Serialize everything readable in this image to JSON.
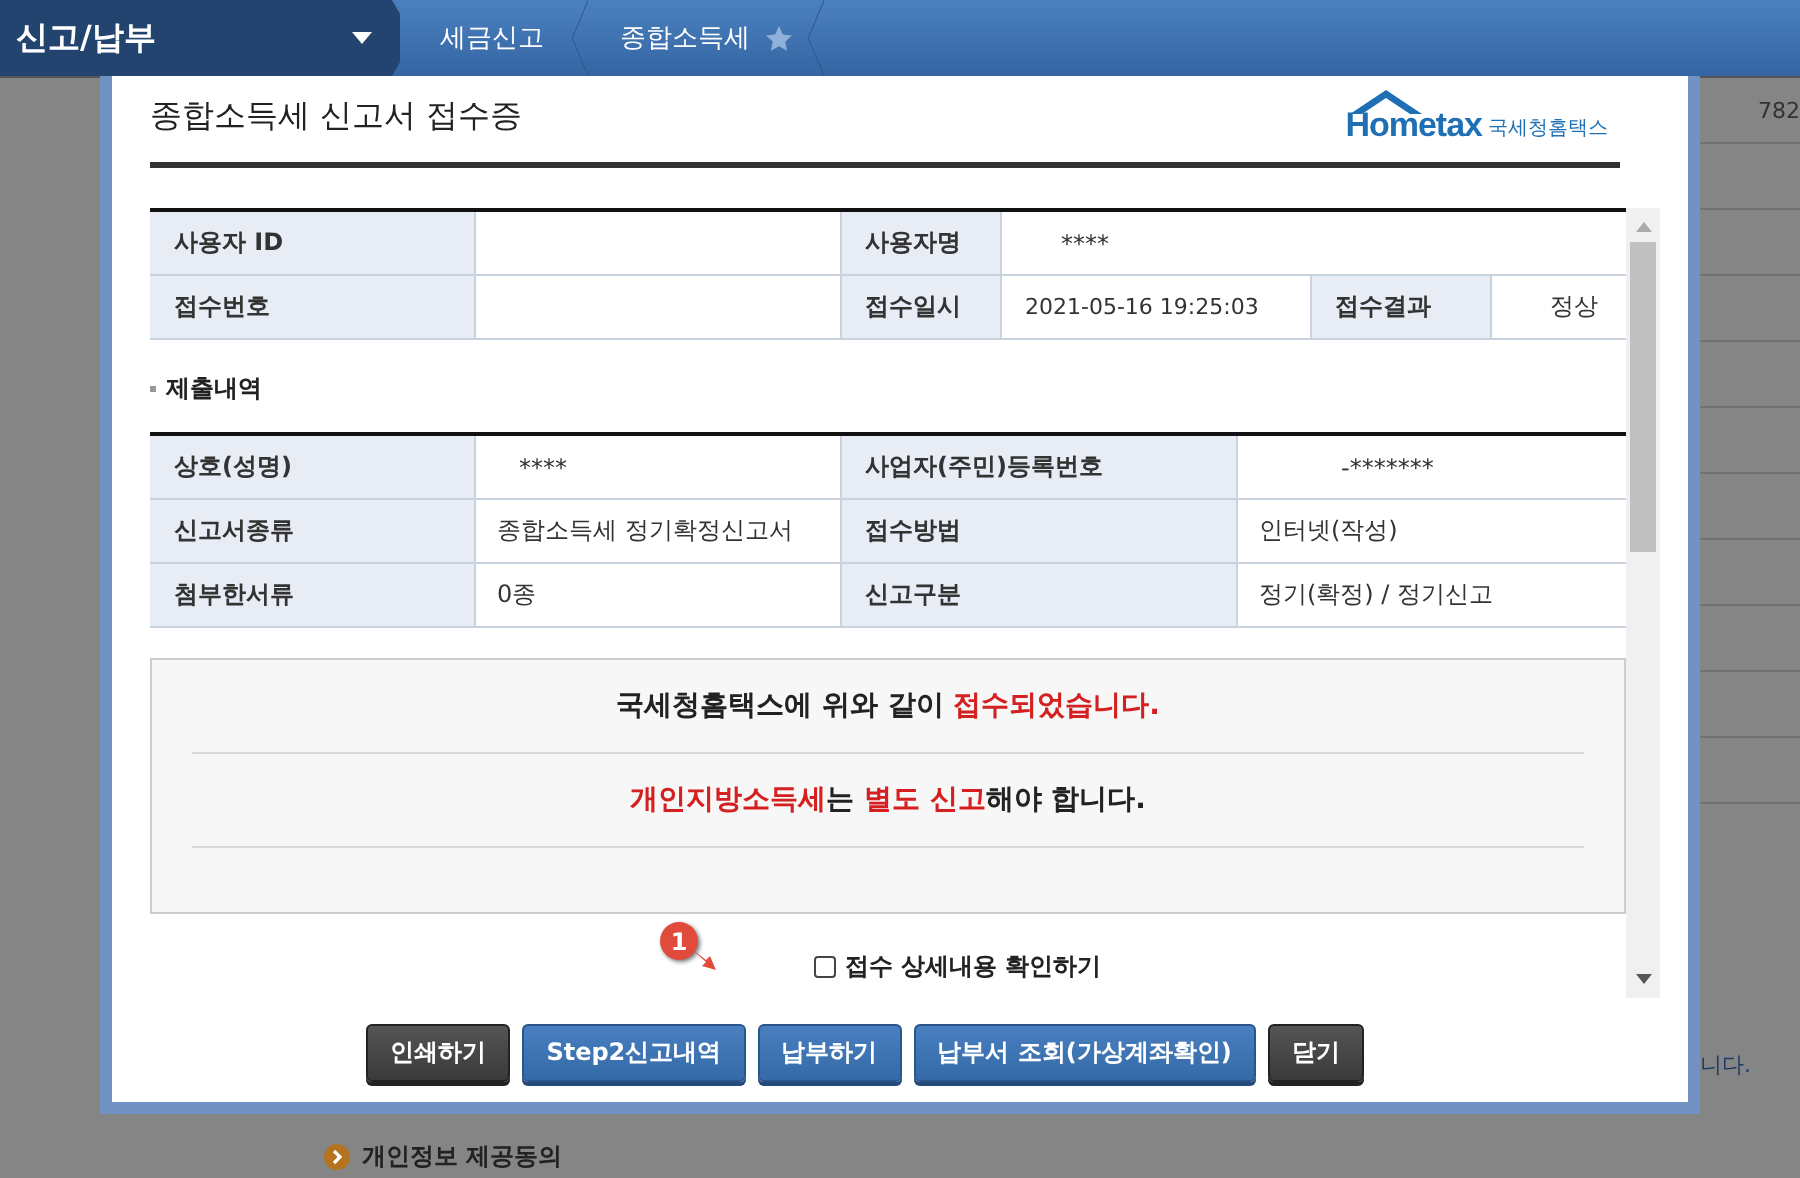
{
  "nav": {
    "menu": "신고/납부",
    "breadcrumbs": [
      "세금신고",
      "종합소득세"
    ]
  },
  "background": {
    "side_value": "782",
    "notice_tail": "니다.",
    "section": "개인정보 제공동의"
  },
  "dialog": {
    "title": "종합소득세 신고서 접수증",
    "logo": {
      "brand": "Hometax",
      "name": "국세청홈택스"
    },
    "receipt_rows": [
      [
        {
          "kind": "label",
          "text": "사용자 ID"
        },
        {
          "kind": "value"
        },
        {
          "kind": "label",
          "text": "사용자명"
        },
        {
          "kind": "value",
          "text": "****"
        }
      ],
      [
        {
          "kind": "label",
          "text": "접수번호"
        },
        {
          "kind": "value"
        },
        {
          "kind": "label",
          "text": "접수일시"
        },
        {
          "kind": "value",
          "text": "2021-05-16 19:25:03"
        },
        {
          "kind": "label",
          "text": "접수결과"
        },
        {
          "kind": "value",
          "text": "정상"
        }
      ]
    ],
    "section_title": "제출내역",
    "detail_rows": [
      [
        {
          "kind": "label",
          "text": "상호(성명)"
        },
        {
          "kind": "value",
          "text": "****"
        },
        {
          "kind": "label",
          "text": "사업자(주민)등록번호"
        },
        {
          "kind": "value",
          "text": "-*******"
        }
      ],
      [
        {
          "kind": "label",
          "text": "신고서종류"
        },
        {
          "kind": "value",
          "text": "종합소득세 정기확정신고서"
        },
        {
          "kind": "label",
          "text": "접수방법"
        },
        {
          "kind": "value",
          "text": "인터넷(작성)"
        }
      ],
      [
        {
          "kind": "label",
          "text": "첨부한서류"
        },
        {
          "kind": "value",
          "text": "0종"
        },
        {
          "kind": "label",
          "text": "신고구분"
        },
        {
          "kind": "value",
          "text": "정기(확정) / 정기신고"
        }
      ]
    ],
    "messages": [
      [
        {
          "text": "국세청홈택스에 위와 같이 ",
          "emphasis": false
        },
        {
          "text": "접수되었습니다.",
          "emphasis": true
        }
      ],
      [
        {
          "text": "개인지방소득세",
          "emphasis": true
        },
        {
          "text": "는 ",
          "emphasis": false
        },
        {
          "text": "별도 신고",
          "emphasis": true
        },
        {
          "text": "해야 합니다.",
          "emphasis": false
        }
      ]
    ],
    "checkbox": {
      "label": "접수 상세내용 확인하기",
      "checked": false
    },
    "callout": "1",
    "buttons": [
      {
        "label": "인쇄하기",
        "kind": "dark"
      },
      {
        "label": "Step2신고내역",
        "kind": "primary"
      },
      {
        "label": "납부하기",
        "kind": "primary"
      },
      {
        "label": "납부서 조회(가상계좌확인)",
        "kind": "primary"
      },
      {
        "label": "닫기",
        "kind": "dark"
      }
    ]
  }
}
